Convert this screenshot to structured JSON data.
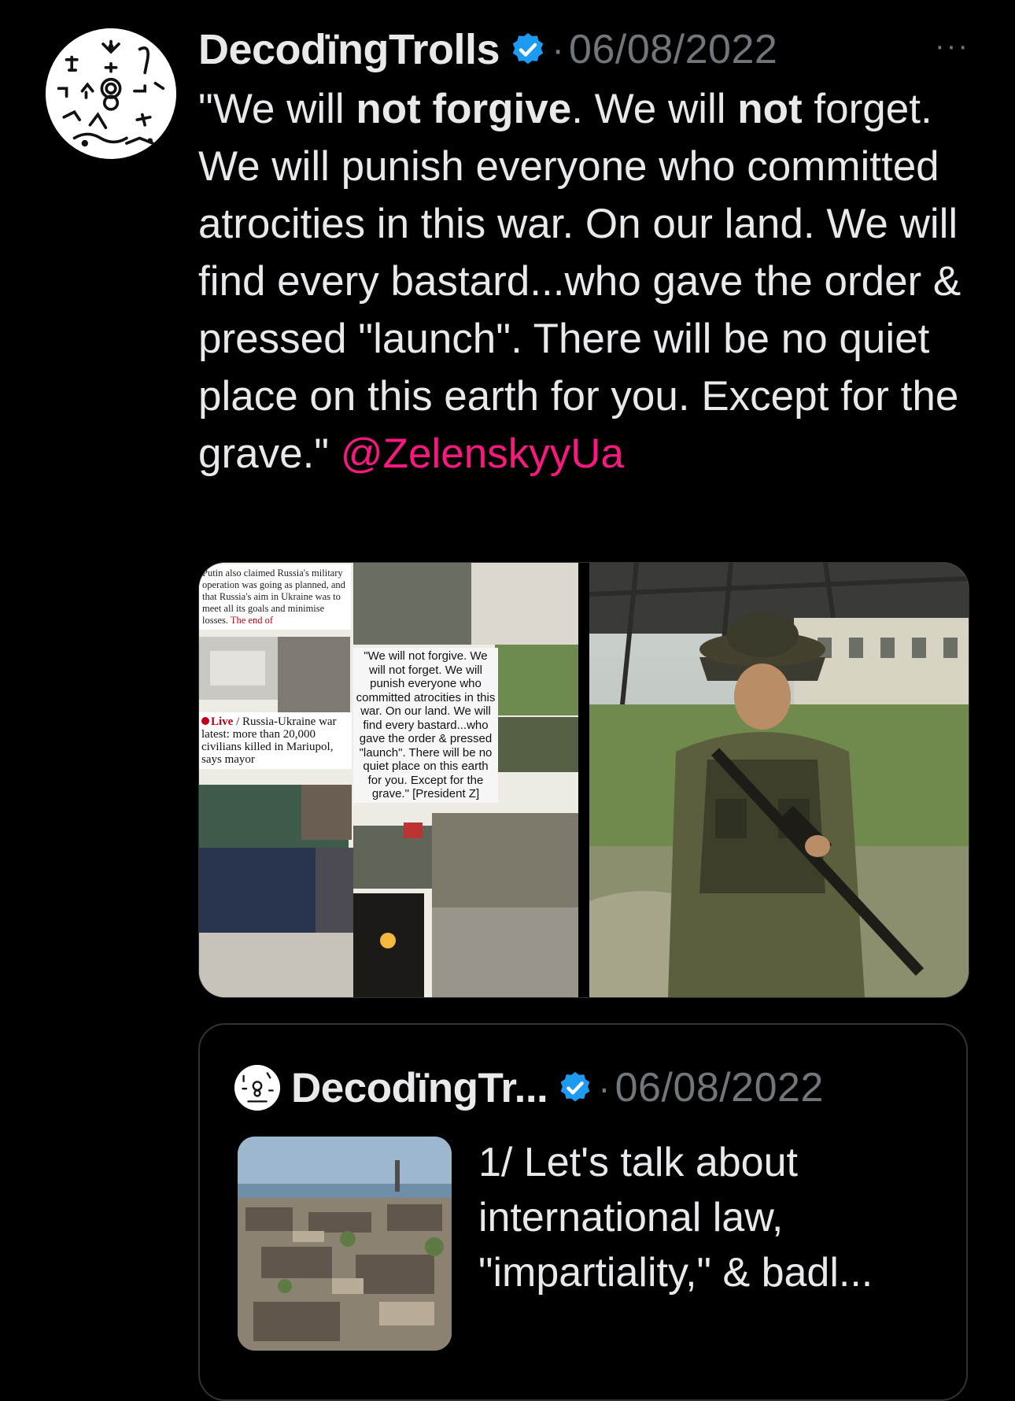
{
  "tweet": {
    "author_name": "DecodïngTrolls",
    "separator": "·",
    "date": "06/08/2022",
    "more_label": "···",
    "text_parts": {
      "p1": "\"We will ",
      "p2_bold": "not forgive",
      "p3": ". We will ",
      "p4_bold": "not",
      "p5": " forget. We will punish everyone who committed atrocities in this war. On our land. We will find every bastard...who gave the order & pressed \"launch\". There will be no quiet place on this earth for you. Except for the grave.\" ",
      "mention": "@ZelenskyyUa"
    },
    "mention_color": "#f91880",
    "verified_color": "#1d9bf0",
    "media": {
      "collage": {
        "caption": "Putin also claimed Russia's military operation was going as planned, and that Russia's aim in Ukraine was to meet all its goals and minimise losses.",
        "caption_end": " The end of",
        "headline_live": "Live",
        "headline": " / Russia-Ukraine war latest: more than 20,000 civilians killed in Mariupol, says mayor",
        "quote": "\"We will not forgive. We will not forget. We will punish everyone who committed atrocities in this war. On our land. We will find every bastard...who gave the order & pressed \"launch\". There will be no quiet place on this earth for you. Except for the grave.\" [President Z]"
      },
      "photo_icon": "soldier-photo"
    }
  },
  "quoted_tweet": {
    "author_name": "DecodïngTr...",
    "separator": "·",
    "date": "06/08/2022",
    "text": "1/ Let's talk about international law, \"impartiality,\" & badl...",
    "thumbnail_icon": "city-ruins-photo"
  },
  "colors": {
    "background": "#000000",
    "text": "#e7e9ea",
    "muted": "#71767b",
    "border": "#2f3336"
  }
}
